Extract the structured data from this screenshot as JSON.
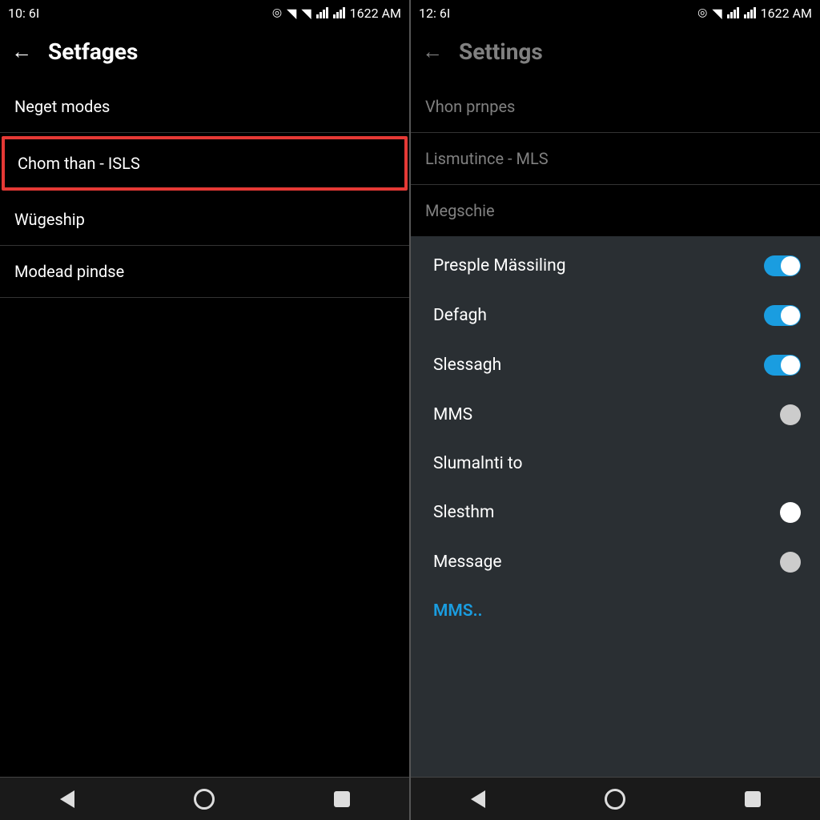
{
  "left": {
    "status": {
      "time": "10: 6I",
      "clock": "1622 AM"
    },
    "title": "Setfages",
    "items": [
      {
        "label": "Neget modes",
        "highlight": false
      },
      {
        "label": "Chom than - ISLS",
        "highlight": true
      },
      {
        "label": "Wügeship",
        "highlight": false
      },
      {
        "label": "Modead pindse",
        "highlight": false
      }
    ]
  },
  "right": {
    "status": {
      "time": "12: 6I",
      "clock": "1622 AM"
    },
    "title": "Settings",
    "top_items": [
      {
        "label": "Vhon prnpes"
      },
      {
        "label": "Lismutince - MLS"
      },
      {
        "label": "Megschie"
      }
    ],
    "toggles": [
      {
        "label": "Presple Mässiling",
        "type": "toggle",
        "on": true
      },
      {
        "label": "Defagh",
        "type": "toggle",
        "on": true
      },
      {
        "label": "Slessagh",
        "type": "toggle",
        "on": true
      },
      {
        "label": "MMS",
        "type": "circle",
        "on": false
      },
      {
        "label": "Slumalnti to",
        "type": "none",
        "on": false
      },
      {
        "label": "Slesthm",
        "type": "circle",
        "on": false
      },
      {
        "label": "Message",
        "type": "circle",
        "on": false
      }
    ],
    "link": "MMS.."
  }
}
